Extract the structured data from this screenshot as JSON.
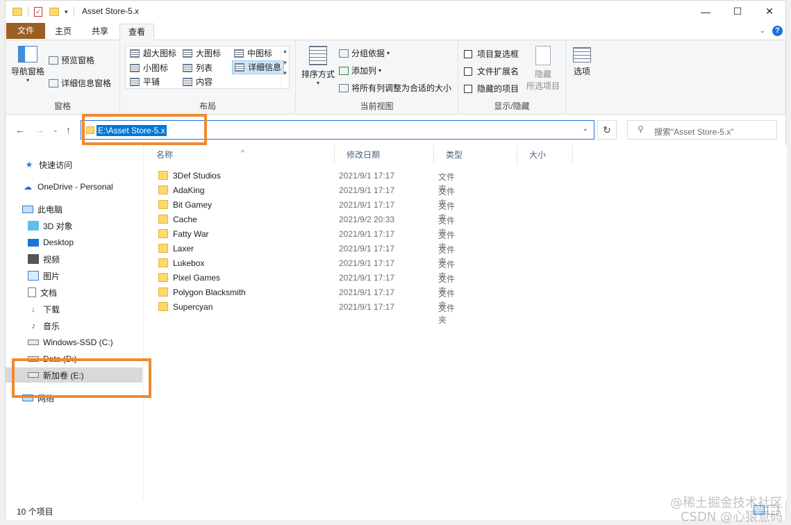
{
  "window": {
    "title": "Asset Store-5.x",
    "controls": {
      "minimize": "—",
      "maximize": "☐",
      "close": "✕"
    }
  },
  "ribbon_tabs": [
    "文件",
    "主页",
    "共享",
    "查看"
  ],
  "active_tab": "查看",
  "ribbon": {
    "panes": {
      "nav_pane": "导航窗格",
      "preview_pane": "预览窗格",
      "details_pane": "详细信息窗格",
      "label": "窗格"
    },
    "layout": {
      "items": [
        "超大图标",
        "大图标",
        "中图标",
        "小图标",
        "列表",
        "详细信息",
        "平铺",
        "内容"
      ],
      "selected": "详细信息",
      "label": "布局"
    },
    "current_view": {
      "sort_by": "排序方式",
      "group_by": "分组依据",
      "add_columns": "添加列",
      "size_all_columns": "将所有列调整为合适的大小",
      "label": "当前视图"
    },
    "show_hide": {
      "item_checkboxes": "项目复选框",
      "file_extensions": "文件扩展名",
      "hidden_items": "隐藏的项目",
      "hide_selected_1": "隐藏",
      "hide_selected_2": "所选项目",
      "label": "显示/隐藏"
    },
    "options": "选项"
  },
  "address": {
    "path": "E:\\Asset Store-5.x",
    "search_placeholder": "搜索\"Asset Store-5.x\""
  },
  "sidebar": [
    {
      "label": "快速访问",
      "icon": "star-icon"
    },
    {
      "label": "OneDrive - Personal",
      "icon": "cloud-icon"
    },
    {
      "label": "此电脑",
      "icon": "computer-icon"
    },
    {
      "label": "3D 对象",
      "icon": "cube-icon"
    },
    {
      "label": "Desktop",
      "icon": "desktop-icon"
    },
    {
      "label": "视频",
      "icon": "video-icon"
    },
    {
      "label": "图片",
      "icon": "picture-icon"
    },
    {
      "label": "文档",
      "icon": "document-icon"
    },
    {
      "label": "下载",
      "icon": "download-icon"
    },
    {
      "label": "音乐",
      "icon": "music-icon"
    },
    {
      "label": "Windows-SSD (C:)",
      "icon": "drive-icon"
    },
    {
      "label": "Data (D:)",
      "icon": "drive-icon"
    },
    {
      "label": "新加卷 (E:)",
      "icon": "drive-icon"
    },
    {
      "label": "网络",
      "icon": "network-icon"
    }
  ],
  "columns": [
    "名称",
    "修改日期",
    "类型",
    "大小"
  ],
  "files": [
    {
      "name": "3Def Studios",
      "date": "2021/9/1 17:17",
      "type": "文件夹"
    },
    {
      "name": "AdaKing",
      "date": "2021/9/1 17:17",
      "type": "文件夹"
    },
    {
      "name": "Bit Gamey",
      "date": "2021/9/1 17:17",
      "type": "文件夹"
    },
    {
      "name": "Cache",
      "date": "2021/9/2 20:33",
      "type": "文件夹"
    },
    {
      "name": "Fatty War",
      "date": "2021/9/1 17:17",
      "type": "文件夹"
    },
    {
      "name": "Laxer",
      "date": "2021/9/1 17:17",
      "type": "文件夹"
    },
    {
      "name": "Lukebox",
      "date": "2021/9/1 17:17",
      "type": "文件夹"
    },
    {
      "name": "Pixel Games",
      "date": "2021/9/1 17:17",
      "type": "文件夹"
    },
    {
      "name": "Polygon Blacksmith",
      "date": "2021/9/1 17:17",
      "type": "文件夹"
    },
    {
      "name": "Supercyan",
      "date": "2021/9/1 17:17",
      "type": "文件夹"
    }
  ],
  "status": "10 个项目",
  "watermark": {
    "line1": "@稀土掘金技术社区",
    "line2": "CSDN @心猿意码"
  },
  "colors": {
    "accent": "#0078d7",
    "file_tab": "#9b5e23",
    "highlight": "#f08a2e",
    "folder": "#ffd86b"
  }
}
